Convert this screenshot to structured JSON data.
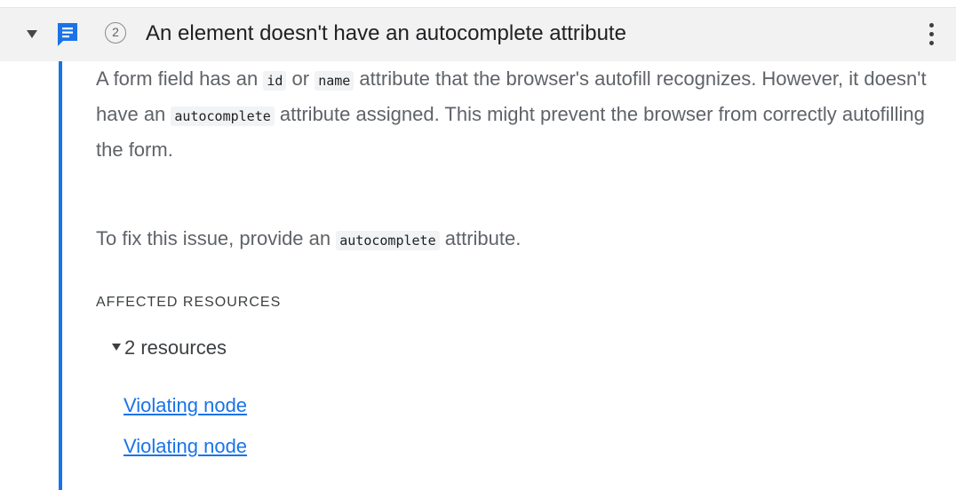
{
  "issue": {
    "count": "2",
    "title": "An element doesn't have an autocomplete attribute",
    "icon": "message-icon",
    "accent_color": "#1a73e8"
  },
  "description": {
    "p1_a": "A form field has an ",
    "p1_code1": "id",
    "p1_b": " or ",
    "p1_code2": "name",
    "p1_c": " attribute that the browser's autofill recognizes. However, it doesn't have an ",
    "p1_code3": "autocomplete",
    "p1_d": " attribute assigned. This might prevent the browser from correctly autofilling the form.",
    "p2_a": "To fix this issue, provide an ",
    "p2_code": "autocomplete",
    "p2_b": " attribute."
  },
  "affected": {
    "heading": "AFFECTED RESOURCES",
    "toggle_label": "2 resources",
    "resources": [
      {
        "label": "Violating node"
      },
      {
        "label": "Violating node"
      }
    ]
  }
}
